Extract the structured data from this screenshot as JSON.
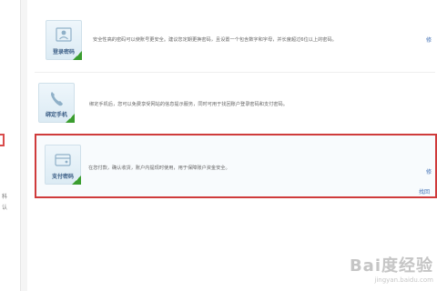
{
  "rows": [
    {
      "label": "登录密码",
      "icon": "id-card-icon",
      "description": "安全性高的密码可以使账号更安全。建议您定期更换密码，且设置一个包含数字和字母，并长度超过6位以上的密码。",
      "link": "修"
    },
    {
      "label": "绑定手机",
      "icon": "phone-icon",
      "description": "绑定手机后，您可以免费享受网站的信息提示服务，同时可用于找回账户登录密码和支付密码。"
    },
    {
      "label": "支付密码",
      "icon": "wallet-icon",
      "description": "在您付款，确认收货，账户内提现时使用，用于保障账户资金安全。",
      "link": "修",
      "link2": "找回"
    }
  ],
  "left_text": [
    "科",
    "认"
  ],
  "watermark": {
    "main": "Bai度经验",
    "sub": "jingyan.baidu.com"
  },
  "colors": {
    "highlight": "#cf3b3b",
    "accent_green": "#3a9d2f",
    "link": "#3f6fb5"
  }
}
